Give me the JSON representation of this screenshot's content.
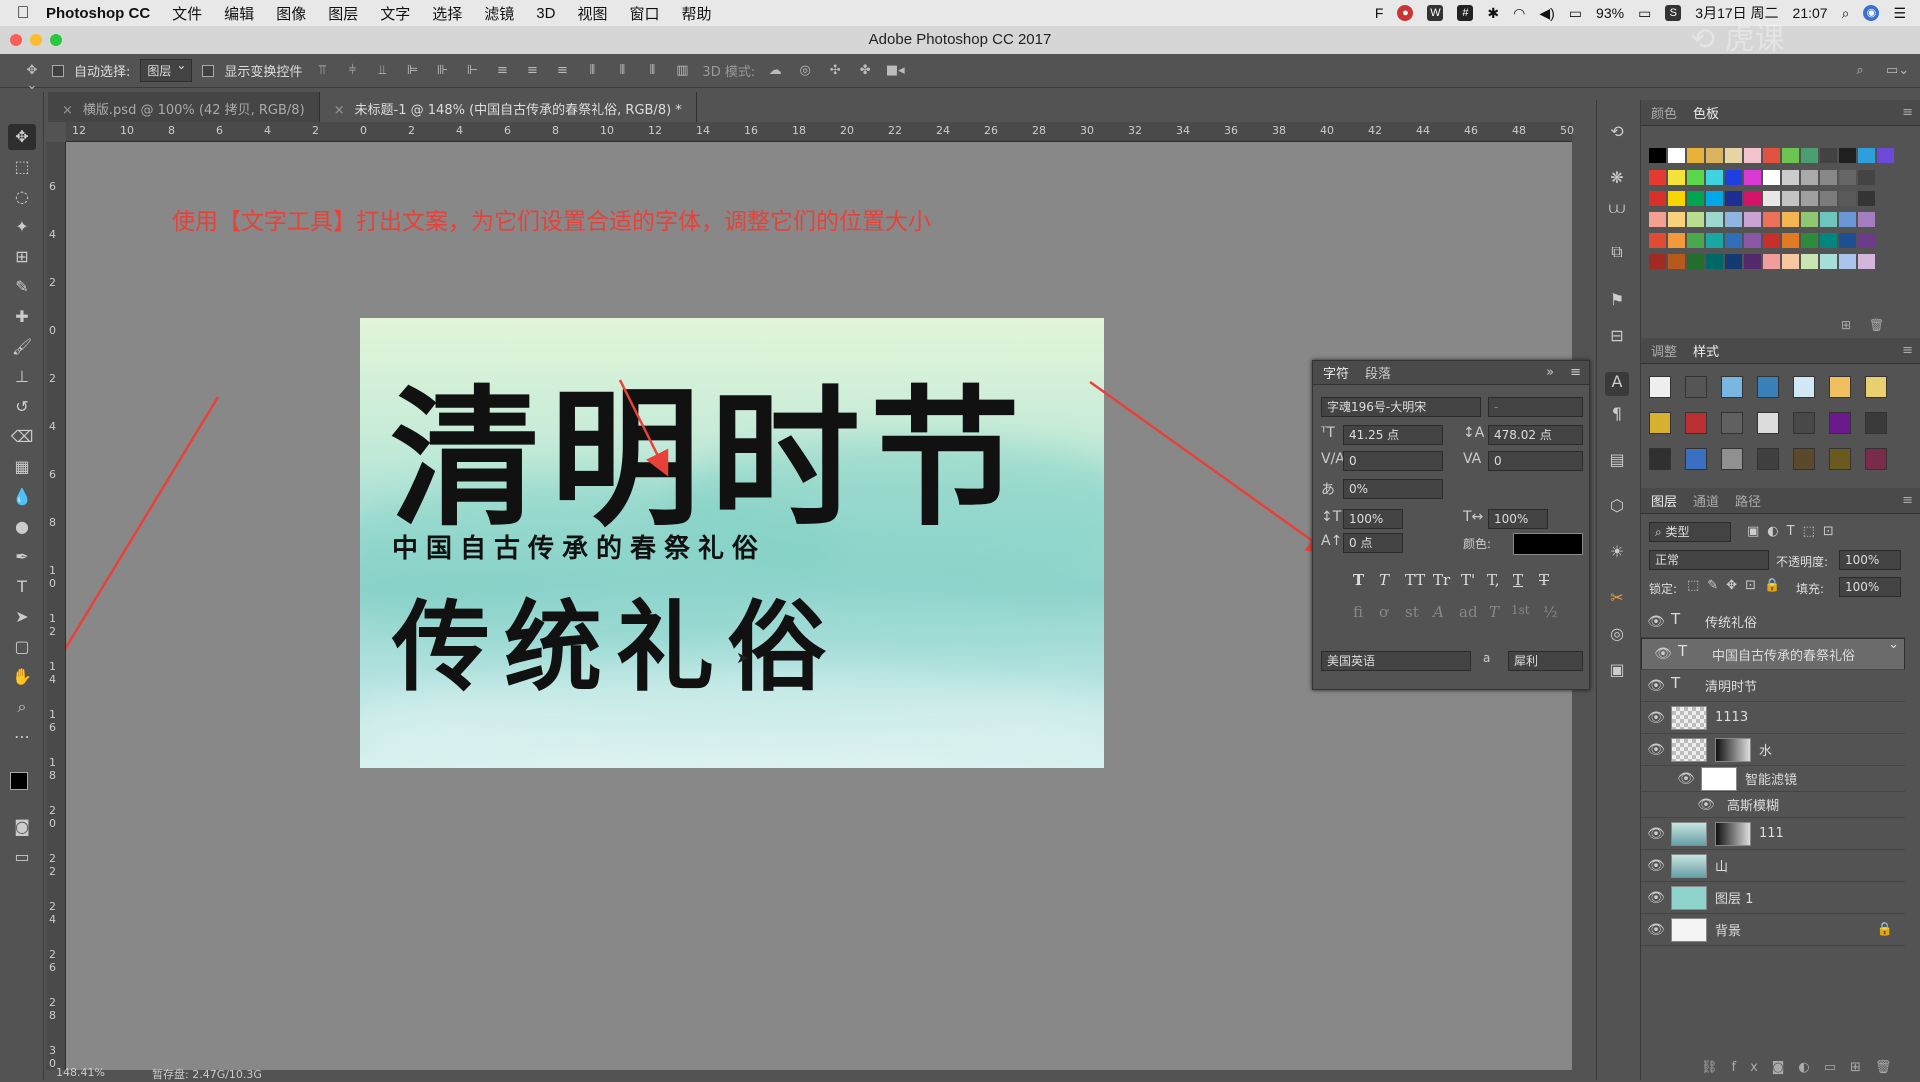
{
  "menubar": {
    "app": "Photoshop CC",
    "items": [
      "文件",
      "编辑",
      "图像",
      "图层",
      "文字",
      "选择",
      "滤镜",
      "3D",
      "视图",
      "窗口",
      "帮助"
    ],
    "battery": "93%",
    "date": "3月17日 周二",
    "time": "21:07"
  },
  "window_title": "Adobe Photoshop CC 2017",
  "options": {
    "auto_select_label": "自动选择:",
    "auto_select_value": "图层",
    "show_transform_label": "显示变换控件",
    "mode_3d_label": "3D 模式:"
  },
  "tabs": [
    {
      "label": "横版.psd @ 100% (42 拷贝, RGB/8)"
    },
    {
      "label": "未标题-1 @ 148% (中国自古传承的春祭礼俗, RGB/8) *"
    }
  ],
  "ruler_h": [
    "12",
    "10",
    "8",
    "6",
    "4",
    "2",
    "0",
    "2",
    "4",
    "6",
    "8",
    "10",
    "12",
    "14",
    "16",
    "18",
    "20",
    "22",
    "24",
    "26",
    "28",
    "30",
    "32",
    "34",
    "36",
    "38",
    "40",
    "42",
    "44",
    "46",
    "48",
    "50"
  ],
  "ruler_v": [
    "6",
    "4",
    "2",
    "0",
    "2",
    "4",
    "6",
    "8",
    "1 0",
    "1 2",
    "1 4",
    "1 6",
    "1 8",
    "2 0",
    "2 2",
    "2 4",
    "2 6",
    "2 8",
    "3 0"
  ],
  "annotation": "使用【文字工具】打出文案，为它们设置合适的字体，调整它们的位置大小",
  "document": {
    "title_text": "清明时节",
    "subtitle_text": "中国自古传承的春祭礼俗",
    "second_text": "传统礼俗"
  },
  "character_panel": {
    "tabs": [
      "字符",
      "段落"
    ],
    "font_family": "字魂196号-大明宋",
    "font_style": "-",
    "font_size": "41.25 点",
    "leading": "478.02 点",
    "kerning": "0",
    "tracking": "0",
    "tsume": "0%",
    "vscale": "100%",
    "hscale": "100%",
    "baseline": "0 点",
    "color_label": "颜色:",
    "language": "美国英语",
    "aa_label": "a",
    "antialias": "犀利",
    "type_buttons": [
      "T",
      "T",
      "TT",
      "Tr",
      "T'",
      "T,",
      "T",
      "T"
    ],
    "ot_buttons": [
      "fi",
      "ơ",
      "st",
      "A",
      "ad",
      "T",
      "1st",
      "½"
    ]
  },
  "swatches_panel": {
    "tabs": [
      "颜色",
      "色板"
    ],
    "row1": [
      "#000000",
      "#ffffff",
      "#e8b23a",
      "#d9b35f",
      "#e7d4a4",
      "#f2c3cc",
      "#e25241",
      "#6ec452",
      "#4a9e6f",
      "#424242",
      "#1f1f1f",
      "#2f9fdc",
      "#6a4ad6"
    ],
    "grid": [
      [
        "#e53a2f",
        "#f4e23a",
        "#5ad84a",
        "#3fd3e0",
        "#1f3fe0",
        "#d93ad4",
        "#ffffff",
        "#cccccc",
        "#aaaaaa",
        "#888888",
        "#666666",
        "#444444"
      ],
      [
        "#d9302a",
        "#f7d600",
        "#00a54f",
        "#00a8e6",
        "#1d2f95",
        "#d4146b",
        "#e7e7e7",
        "#c3c3c3",
        "#a0a0a0",
        "#7c7c7c",
        "#595959",
        "#353535"
      ],
      [
        "#f3a093",
        "#f7d27a",
        "#b8dd8f",
        "#9cd8d0",
        "#8fb5e0",
        "#c8a3d3",
        "#eb7259",
        "#f4b654",
        "#8ec971",
        "#6cc6bd",
        "#6b98d5",
        "#a27ec0"
      ],
      [
        "#e24b33",
        "#f19a3b",
        "#4aa84c",
        "#1aa6a2",
        "#2f6fb8",
        "#8a56a6",
        "#c7302a",
        "#e07b23",
        "#2f8a3c",
        "#00857f",
        "#1d4f92",
        "#6b3a89"
      ],
      [
        "#a12a22",
        "#b55a1a",
        "#236d2d",
        "#006864",
        "#143a70",
        "#53296b",
        "#f39c9c",
        "#f8c6a0",
        "#c9e6b2",
        "#a8ded9",
        "#a9c4ea",
        "#d3b6dc"
      ]
    ]
  },
  "adjust_panel": {
    "tabs": [
      "调整",
      "样式"
    ]
  },
  "layers_panel": {
    "tabs": [
      "图层",
      "通道",
      "路径"
    ],
    "filter_label": "类型",
    "blend_mode": "正常",
    "opacity_label": "不透明度:",
    "opacity": "100%",
    "lock_label": "锁定:",
    "fill_label": "填充:",
    "fill": "100%",
    "layers": [
      {
        "name": "传统礼俗",
        "kind": "text"
      },
      {
        "name": "中国自古传承的春祭礼俗",
        "kind": "text",
        "selected": true
      },
      {
        "name": "清明时节",
        "kind": "text"
      },
      {
        "name": "1113",
        "kind": "smart"
      },
      {
        "name": "水",
        "kind": "smart-mask"
      },
      {
        "name": "智能滤镜",
        "kind": "filter"
      },
      {
        "name": "高斯模糊",
        "kind": "filter-item"
      },
      {
        "name": "111",
        "kind": "smart-mask"
      },
      {
        "name": "山",
        "kind": "smart"
      },
      {
        "name": "图层 1",
        "kind": "pixel"
      },
      {
        "name": "背景",
        "kind": "background"
      }
    ]
  },
  "status": {
    "zoom": "148.41%",
    "doc": "暂存盘: 2.47G/10.3G"
  }
}
